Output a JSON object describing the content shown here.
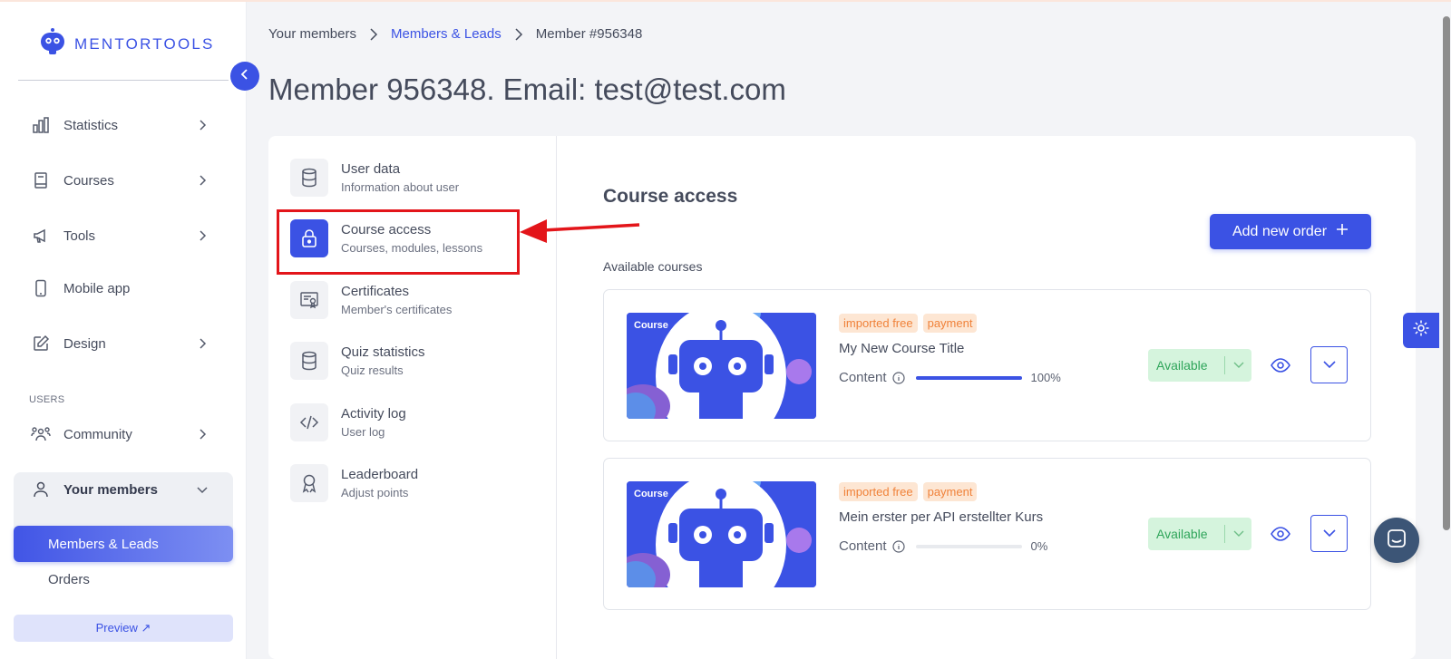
{
  "brand": {
    "name": "MENTORTOOLS"
  },
  "sidebar": {
    "items": [
      {
        "label": "Statistics"
      },
      {
        "label": "Courses"
      },
      {
        "label": "Tools"
      },
      {
        "label": "Mobile app"
      },
      {
        "label": "Design"
      }
    ],
    "section_users": "USERS",
    "users_items": [
      {
        "label": "Community"
      },
      {
        "label": "Your members"
      }
    ],
    "sub_items": [
      {
        "label": "Members & Leads"
      },
      {
        "label": "Orders"
      }
    ],
    "preview_label": "Preview ↗"
  },
  "breadcrumb": {
    "items": [
      "Your members",
      "Members & Leads",
      "Member #956348"
    ]
  },
  "page": {
    "title": "Member 956348. Email: test@test.com"
  },
  "member_menu": [
    {
      "title": "User data",
      "subtitle": "Information about user"
    },
    {
      "title": "Course access",
      "subtitle": "Courses, modules, lessons"
    },
    {
      "title": "Certificates",
      "subtitle": "Member's certificates"
    },
    {
      "title": "Quiz statistics",
      "subtitle": "Quiz results"
    },
    {
      "title": "Activity log",
      "subtitle": "User log"
    },
    {
      "title": "Leaderboard",
      "subtitle": "Adjust points"
    }
  ],
  "course_access": {
    "title": "Course access",
    "add_button": "Add new order",
    "available_label": "Available courses",
    "courses": [
      {
        "thumb_tag": "Course",
        "badges": [
          "imported free",
          "payment"
        ],
        "title": "My New Course Title",
        "content_label": "Content",
        "progress": 100,
        "progress_text": "100%",
        "status": "Available"
      },
      {
        "thumb_tag": "Course",
        "badges": [
          "imported free",
          "payment"
        ],
        "title": "Mein erster per API erstellter Kurs",
        "content_label": "Content",
        "progress": 0,
        "progress_text": "0%",
        "status": "Available"
      }
    ]
  },
  "colors": {
    "accent": "#3b52e4",
    "highlight_box": "#e3151a",
    "available_bg": "#d5f4dd",
    "badge_bg": "#fde6d3"
  }
}
